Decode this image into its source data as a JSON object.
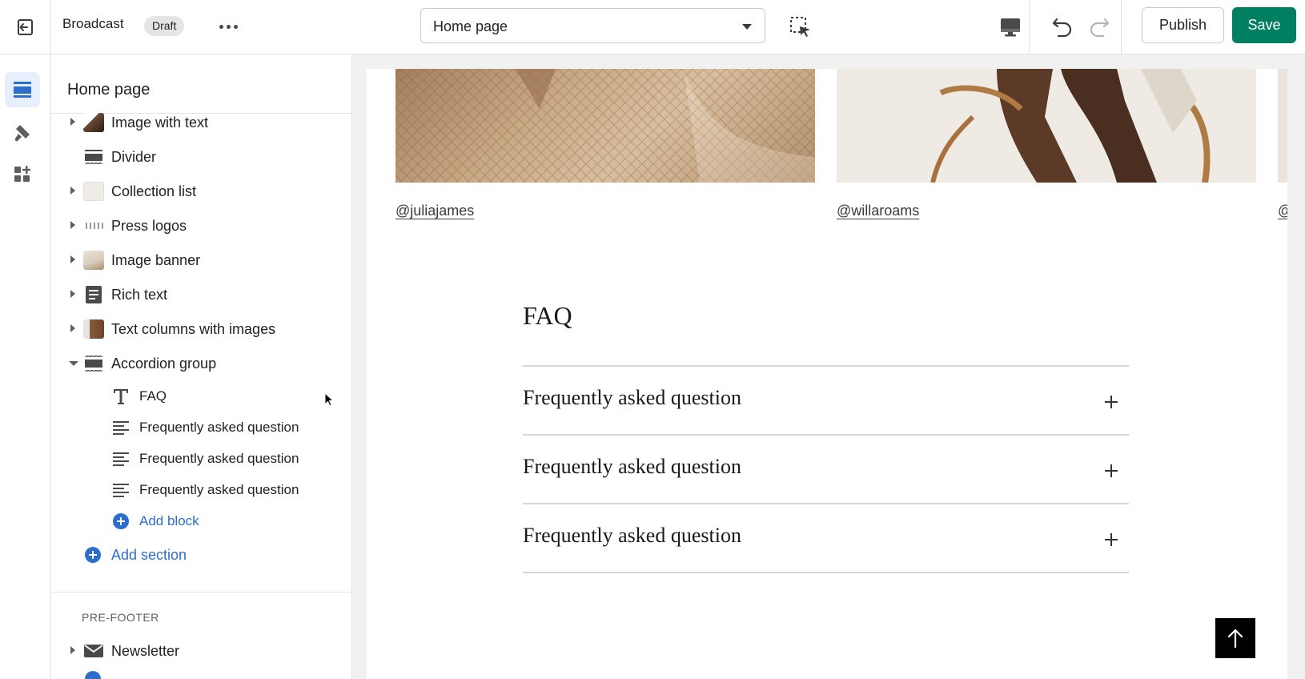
{
  "topbar": {
    "theme_name": "Broadcast",
    "status_badge": "Draft",
    "page_select": "Home page",
    "publish_label": "Publish",
    "save_label": "Save"
  },
  "rail": {
    "items": [
      "sections-icon",
      "theme-settings-icon",
      "app-embeds-icon"
    ]
  },
  "sidebar": {
    "title": "Home page",
    "sections": [
      {
        "label": "Image with text",
        "icon": "image-thumbnail"
      },
      {
        "label": "Divider",
        "icon": "section-icon"
      },
      {
        "label": "Collection list",
        "icon": "image-thumbnail"
      },
      {
        "label": "Press logos",
        "icon": "image-thumbnail"
      },
      {
        "label": "Image banner",
        "icon": "image-thumbnail"
      },
      {
        "label": "Rich text",
        "icon": "text-block-icon"
      },
      {
        "label": "Text columns with images",
        "icon": "image-thumbnail"
      },
      {
        "label": "Accordion group",
        "icon": "section-icon"
      }
    ],
    "blocks": [
      {
        "label": "FAQ",
        "icon": "heading-icon"
      },
      {
        "label": "Frequently asked question",
        "icon": "paragraph-icon"
      },
      {
        "label": "Frequently asked question",
        "icon": "paragraph-icon"
      },
      {
        "label": "Frequently asked question",
        "icon": "paragraph-icon"
      }
    ],
    "add_block_label": "Add block",
    "add_section_label": "Add section",
    "footer_group_label": "PRE-FOOTER",
    "footer_sections": [
      {
        "label": "Newsletter",
        "icon": "mail-icon"
      }
    ]
  },
  "preview": {
    "handles": [
      "@juliajames",
      "@willaroams",
      "@"
    ],
    "faq_heading": "FAQ",
    "questions": [
      "Frequently asked question",
      "Frequently asked question",
      "Frequently asked question"
    ]
  },
  "colors": {
    "primary_green": "#008060",
    "link_blue": "#2c6ecb",
    "rail_active_bg": "#e5effd"
  }
}
